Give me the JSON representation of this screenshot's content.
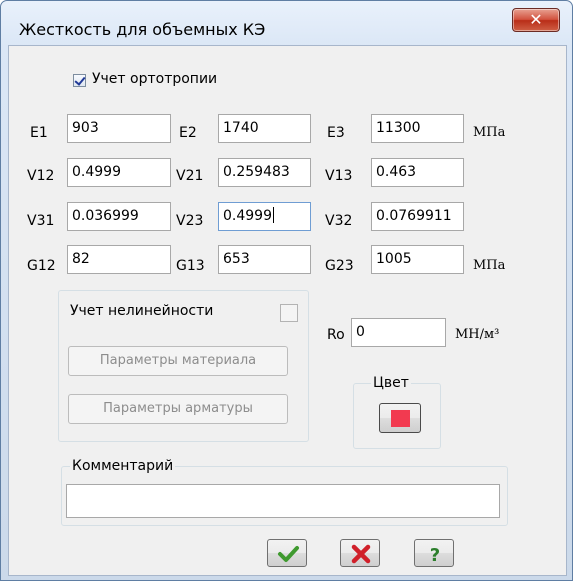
{
  "window": {
    "title": "Жесткость для объемных КЭ"
  },
  "orthotropy": {
    "label": "Учет ортотропии",
    "checked": true
  },
  "rows": [
    {
      "fields": [
        {
          "label": "E1",
          "value": "903"
        },
        {
          "label": "E2",
          "value": "1740"
        },
        {
          "label": "E3",
          "value": "11300"
        }
      ],
      "unit": "МПа"
    },
    {
      "fields": [
        {
          "label": "V12",
          "value": "0.4999"
        },
        {
          "label": "V21",
          "value": "0.259483"
        },
        {
          "label": "V13",
          "value": "0.463"
        }
      ],
      "unit": ""
    },
    {
      "fields": [
        {
          "label": "V31",
          "value": "0.036999"
        },
        {
          "label": "V23",
          "value": "0.4999"
        },
        {
          "label": "V32",
          "value": "0.0769911"
        }
      ],
      "unit": ""
    },
    {
      "fields": [
        {
          "label": "G12",
          "value": "82"
        },
        {
          "label": "G13",
          "value": "653"
        },
        {
          "label": "G23",
          "value": "1005"
        }
      ],
      "unit": "МПа"
    }
  ],
  "nonlinear": {
    "label": "Учет нелинейности",
    "checked": false,
    "material_button": "Параметры материала",
    "rebar_button": "Параметры арматуры"
  },
  "ro": {
    "label": "Ro",
    "value": "0",
    "unit": "МН/м³"
  },
  "color": {
    "label": "Цвет",
    "swatch": "#f23a50"
  },
  "comment": {
    "label": "Комментарий",
    "value": ""
  },
  "buttons": {
    "ok_icon": "checkmark-icon",
    "cancel_icon": "red-x-icon",
    "help_icon": "question-icon"
  }
}
